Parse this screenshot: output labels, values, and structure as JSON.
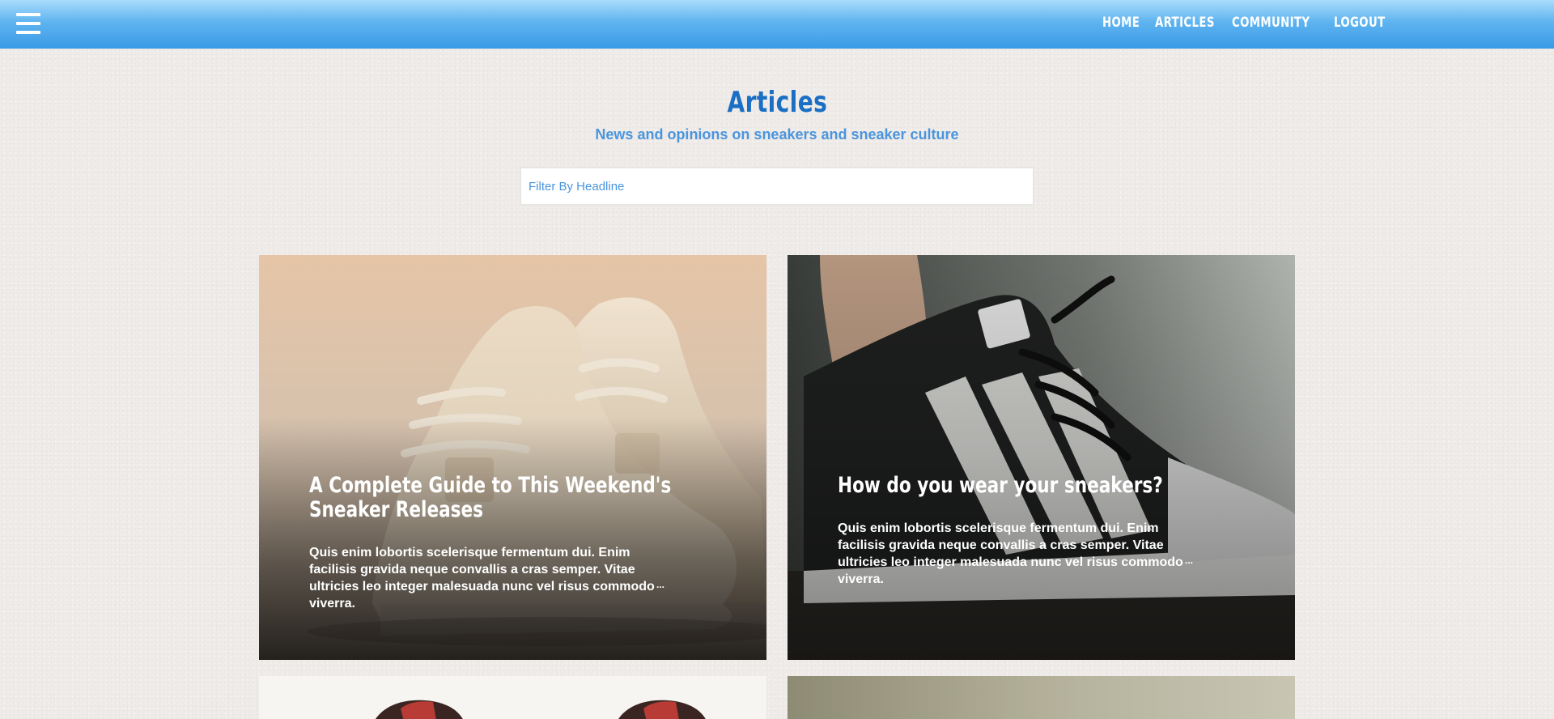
{
  "nav": {
    "menu_icon": "hamburger-menu-icon",
    "links": [
      "HOME",
      "ARTICLES",
      "COMMUNITY",
      "LOGOUT"
    ]
  },
  "header": {
    "title": "Articles",
    "subtitle": "News and opinions on sneakers and sneaker culture"
  },
  "filter": {
    "placeholder": "Filter By Headline",
    "value": ""
  },
  "articles": [
    {
      "title": "A Complete Guide to This Weekend's Sneaker Releases",
      "excerpt": "Quis enim lobortis scelerisque fermentum dui. Enim facilisis gravida neque convallis a cras semper. Vitae ultricies leo integer malesuada nunc vel risus commodo viverra.",
      "more": "..."
    },
    {
      "title": "How do you wear your sneakers?",
      "excerpt": "Quis enim lobortis scelerisque fermentum dui. Enim facilisis gravida neque convallis a cras semper. Vitae ultricies leo integer malesuada nunc vel risus commodo viverra.",
      "more": "..."
    }
  ],
  "colors": {
    "nav_top": "#a9dcfc",
    "nav_bottom": "#3a9ae6",
    "title": "#1a6fc4",
    "subtitle": "#4a95dd",
    "page_bg": "#efebe8"
  }
}
